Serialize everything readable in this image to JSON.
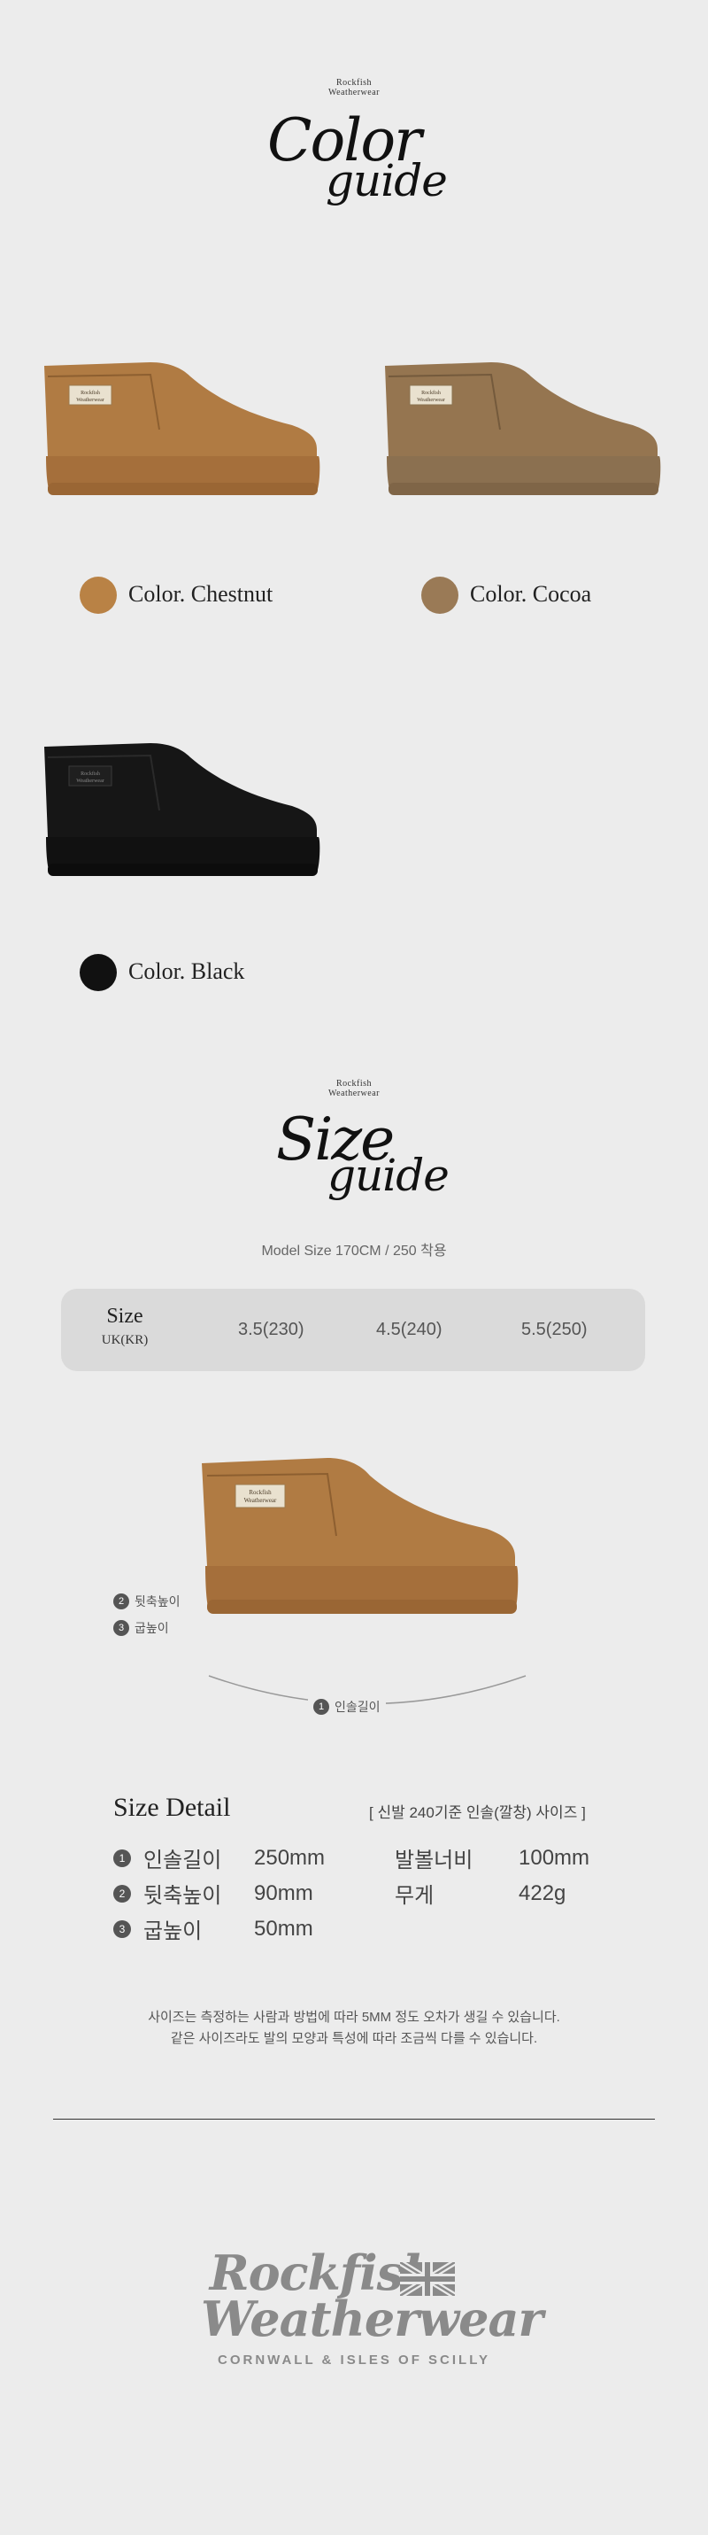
{
  "brand": {
    "line1": "Rockfish",
    "line2": "Weatherwear"
  },
  "color_guide": {
    "title_a": "Color",
    "title_b": "guide",
    "colors": [
      {
        "label": "Color. Chestnut",
        "hex": "#b98245"
      },
      {
        "label": "Color. Cocoa",
        "hex": "#9a7a56"
      },
      {
        "label": "Color. Black",
        "hex": "#111111"
      }
    ],
    "boot_tag": {
      "line1": "Rockfish",
      "line2": "Weatherwear"
    }
  },
  "size_guide": {
    "title_a": "Size",
    "title_b": "guide",
    "model_note": "Model Size 170CM / 250 착용",
    "table": {
      "head": "Size",
      "sub": "UK(KR)",
      "values": [
        "3.5(230)",
        "4.5(240)",
        "5.5(250)"
      ]
    },
    "diagram": {
      "heel_height": {
        "num": "2",
        "label": "뒷축높이"
      },
      "sole_height": {
        "num": "3",
        "label": "굽높이"
      },
      "insole_length": {
        "num": "1",
        "label": "인솔길이"
      }
    }
  },
  "size_detail": {
    "title": "Size Detail",
    "note": "[ 신발 240기준 인솔(깔창) 사이즈 ]",
    "rows": [
      {
        "num": "1",
        "label": "인솔길이",
        "value": "250mm"
      },
      {
        "num": "2",
        "label": "뒷축높이",
        "value": "90mm"
      },
      {
        "num": "3",
        "label": "굽높이",
        "value": "50mm"
      }
    ],
    "extra": [
      {
        "label": "발볼너비",
        "value": "100mm"
      },
      {
        "label": "무게",
        "value": "422g"
      }
    ]
  },
  "notice": {
    "line1": "사이즈는 측정하는 사람과 방법에 따라 5MM 정도 오차가 생길 수 있습니다.",
    "line2": "같은 사이즈라도 발의 모양과 특성에 따라 조금씩 다를 수 있습니다."
  },
  "footer": {
    "logo_line1": "Rockfish",
    "logo_line2": "Weatherwear",
    "tagline": "CORNWALL & ISLES OF SCILLY",
    "logo_color": "#8a8a8a"
  }
}
